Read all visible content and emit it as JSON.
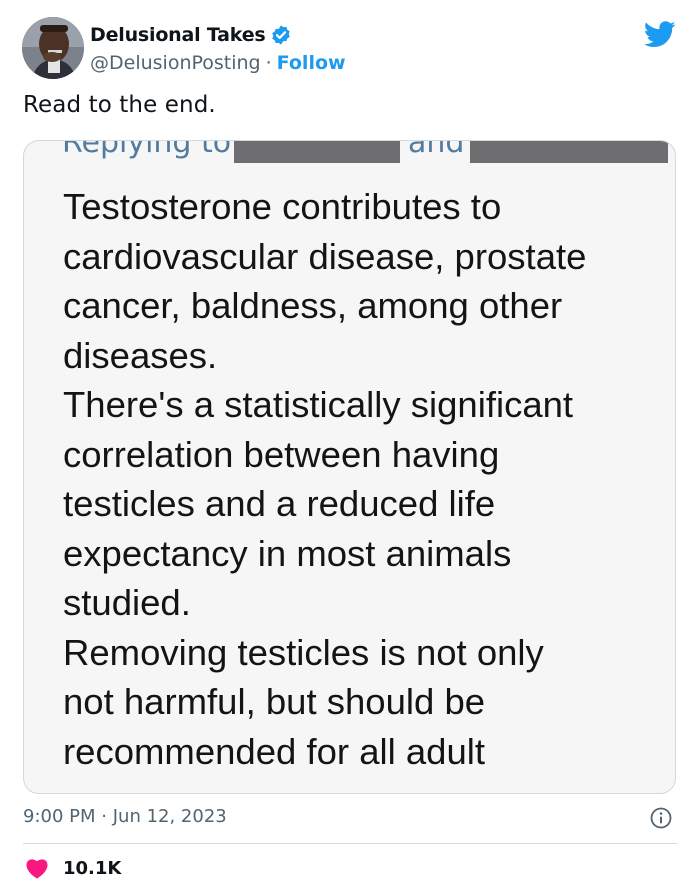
{
  "author": {
    "display_name": "Delusional Takes",
    "handle": "@DelusionPosting",
    "separator": "·",
    "follow_label": "Follow"
  },
  "tweet": {
    "text": "Read to the end."
  },
  "embedded_screenshot": {
    "reply_label": "Replying to",
    "and_label": "and",
    "lines": [
      "Testosterone contributes to",
      "cardiovascular disease, prostate",
      "cancer, baldness, among other",
      "diseases.",
      "There's a statistically significant",
      "correlation between having",
      "testicles and a reduced life",
      "expectancy in most animals",
      "studied.",
      "Removing testicles is not only",
      "not harmful, but should be",
      "recommended for all adult"
    ]
  },
  "footer": {
    "time": "9:00 PM",
    "separator": "·",
    "date": "Jun 12, 2023",
    "like_count": "10.1K"
  },
  "icons": {
    "verified": "verified-badge-icon",
    "twitter": "twitter-bird-icon",
    "info": "info-icon",
    "heart": "heart-icon"
  },
  "colors": {
    "accent": "#1d9bf0",
    "like": "#f91880",
    "muted_text": "#536471",
    "border": "#cfd9de"
  }
}
